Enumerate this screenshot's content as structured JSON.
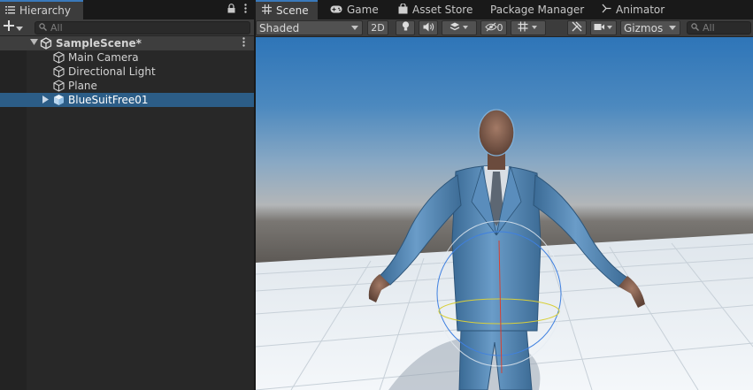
{
  "hierarchy": {
    "tab_label": "Hierarchy",
    "search_placeholder": "All",
    "scene": {
      "name": "SampleScene*"
    },
    "items": [
      {
        "label": "Main Camera",
        "icon": "gameobject-cube-icon"
      },
      {
        "label": "Directional Light",
        "icon": "gameobject-cube-icon"
      },
      {
        "label": "Plane",
        "icon": "gameobject-cube-icon"
      },
      {
        "label": "BlueSuitFree01",
        "icon": "prefab-cube-icon",
        "selected": true
      }
    ]
  },
  "tabs": [
    {
      "label": "Scene",
      "icon": "grid-icon",
      "active": true
    },
    {
      "label": "Game",
      "icon": "gamepad-icon"
    },
    {
      "label": "Asset Store",
      "icon": "shopping-bag-icon"
    },
    {
      "label": "Package Manager",
      "icon": "package-icon"
    },
    {
      "label": "Animator",
      "icon": "animator-icon"
    }
  ],
  "scene_toolbar": {
    "shading_mode": "Shaded",
    "two_d_label": "2D",
    "hidden_count": "0",
    "gizmos_label": "Gizmos",
    "search_placeholder": "All"
  },
  "colors": {
    "selection": "#2c5d87",
    "active_tab_accent": "#3a79bb",
    "panel_bg": "#282828",
    "toolbar_bg": "#3c3c3c"
  }
}
